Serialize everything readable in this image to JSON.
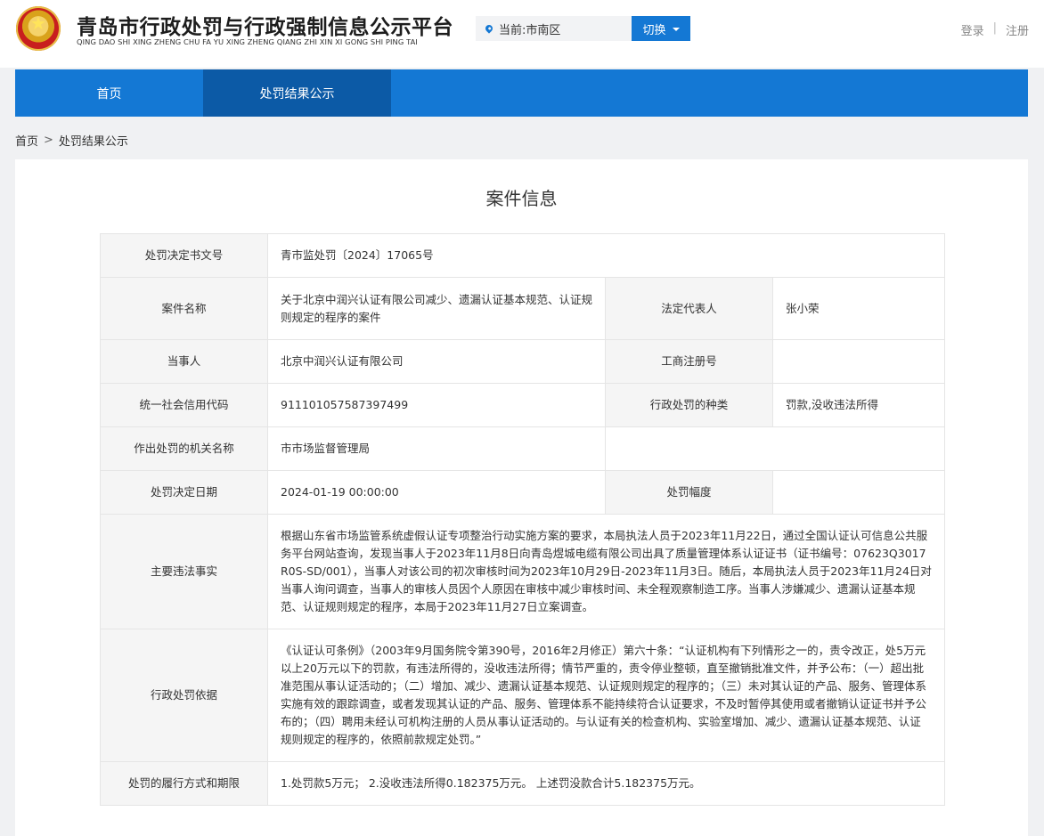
{
  "header": {
    "title": "青岛市行政处罚与行政强制信息公示平台",
    "pinyin": "QING DAO SHI XING ZHENG CHU FA YU XING ZHENG QIANG ZHI XIN XI GONG SHI PING TAI",
    "location": "当前:市南区",
    "switch_label": "切换",
    "login": "登录",
    "separator": "|",
    "register": "注册"
  },
  "nav": {
    "items": [
      {
        "label": "首页"
      },
      {
        "label": "处罚结果公示"
      }
    ]
  },
  "breadcrumb": {
    "home": "首页",
    "arrow": ">",
    "current": "处罚结果公示"
  },
  "case": {
    "title": "案件信息",
    "decision_no_label": "处罚决定书文号",
    "decision_no": "青市监处罚〔2024〕17065号",
    "case_name_label": "案件名称",
    "case_name": "关于北京中润兴认证有限公司减少、遗漏认证基本规范、认证规则规定的程序的案件",
    "legal_rep_label": "法定代表人",
    "legal_rep": "张小荣",
    "party_label": "当事人",
    "party": "北京中润兴认证有限公司",
    "reg_no_label": "工商注册号",
    "reg_no": "",
    "credit_code_label": "统一社会信用代码",
    "credit_code": "91110105758739749​9",
    "penalty_type_label": "行政处罚的种类",
    "penalty_type": "罚款,没收违法所得",
    "authority_label": "作出处罚的机关名称",
    "authority": "市市场监督管理局",
    "decision_date_label": "处罚决定日期",
    "decision_date": "2024-01-19 00:00:00",
    "penalty_range_label": "处罚幅度",
    "penalty_range": "",
    "facts_label": "主要违法事实",
    "facts": "根据山东省市场监管系统虚假认证专项整治行动实施方案的要求，本局执法人员于2023年11月22日，通过全国认证认可信息公共服务平台网站查询，发现当事人于2023年11月8日向青岛煜城电缆有限公司出具了质量管理体系认证证书（证书编号：07623Q3017R0S-SD/001），当事人对该公司的初次审核时间为2023年10月29日-2023年11月3日。随后，本局执法人员于2023年11月24日对当事人询问调查，当事人的审核人员因个人原因在审核中减少审核时间、未全程观察制造工序。当事人涉嫌减少、遗漏认证基本规范、认证规则规定的程序，本局于2023年11月27日立案调查。",
    "basis_label": "行政处罚依据",
    "basis": "《认证认可条例》（2003年9月国务院令第390号，2016年2月修正）第六十条：“认证机构有下列情形之一的，责令改正，处5万元以上20万元以下的罚款，有违法所得的，没收违法所得；情节严重的，责令停业整顿，直至撤销批准文件，并予公布：（一）超出批准范围从事认证活动的；（二）增加、减少、遗漏认证基本规范、认证规则规定的程序的；（三）未对其认证的产品、服务、管理体系实施有效的跟踪调查，或者发现其认证的产品、服务、管理体系不能持续符合认证要求，不及时暂停其使用或者撤销认证证书并予公布的；（四）聘用未经认可机构注册的人员从事认证活动的。与认证有关的检查机构、实验室增加、减少、遗漏认证基本规范、认证规则规定的程序的，依照前款规定处罚。”",
    "execution_label": "处罚的履行方式和期限",
    "execution": "1.处罚款5万元； 2.没收违法所得0.182375万元。 上述罚没款合计5.182375万元。"
  },
  "colors": {
    "brand_blue": "#1478d4",
    "nav_active": "#0c5aa6",
    "label_bg": "#f5f5f5"
  }
}
